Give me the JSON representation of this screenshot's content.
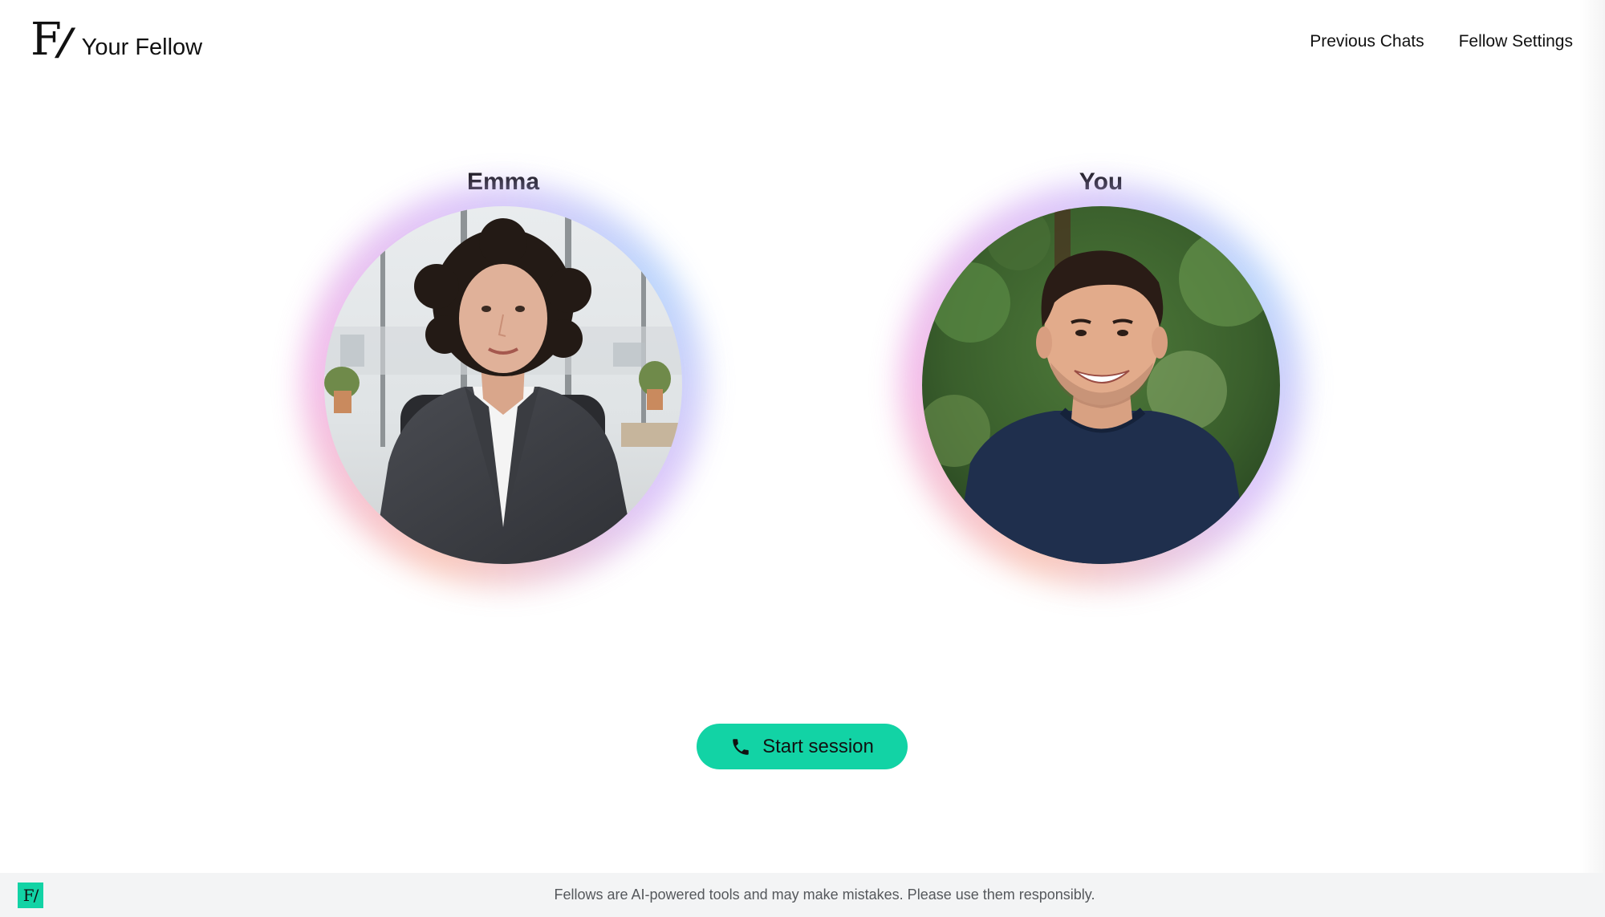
{
  "header": {
    "logo_mark": "F",
    "logo_slash": "/",
    "brand_name": "Your Fellow",
    "nav": [
      {
        "label": "Previous Chats"
      },
      {
        "label": "Fellow Settings"
      }
    ]
  },
  "participants": {
    "fellow": {
      "name": "Emma",
      "avatar": "fellow-portrait"
    },
    "user": {
      "name": "You",
      "avatar": "user-portrait"
    }
  },
  "session": {
    "start_label": "Start session",
    "start_icon": "phone-icon"
  },
  "footer": {
    "logo_text": "F/",
    "disclaimer": "Fellows are AI-powered tools and may make mistakes. Please use them responsibly."
  },
  "colors": {
    "accent": "#12d3a5",
    "footer_bg": "#f3f4f5",
    "text": "#111111"
  }
}
